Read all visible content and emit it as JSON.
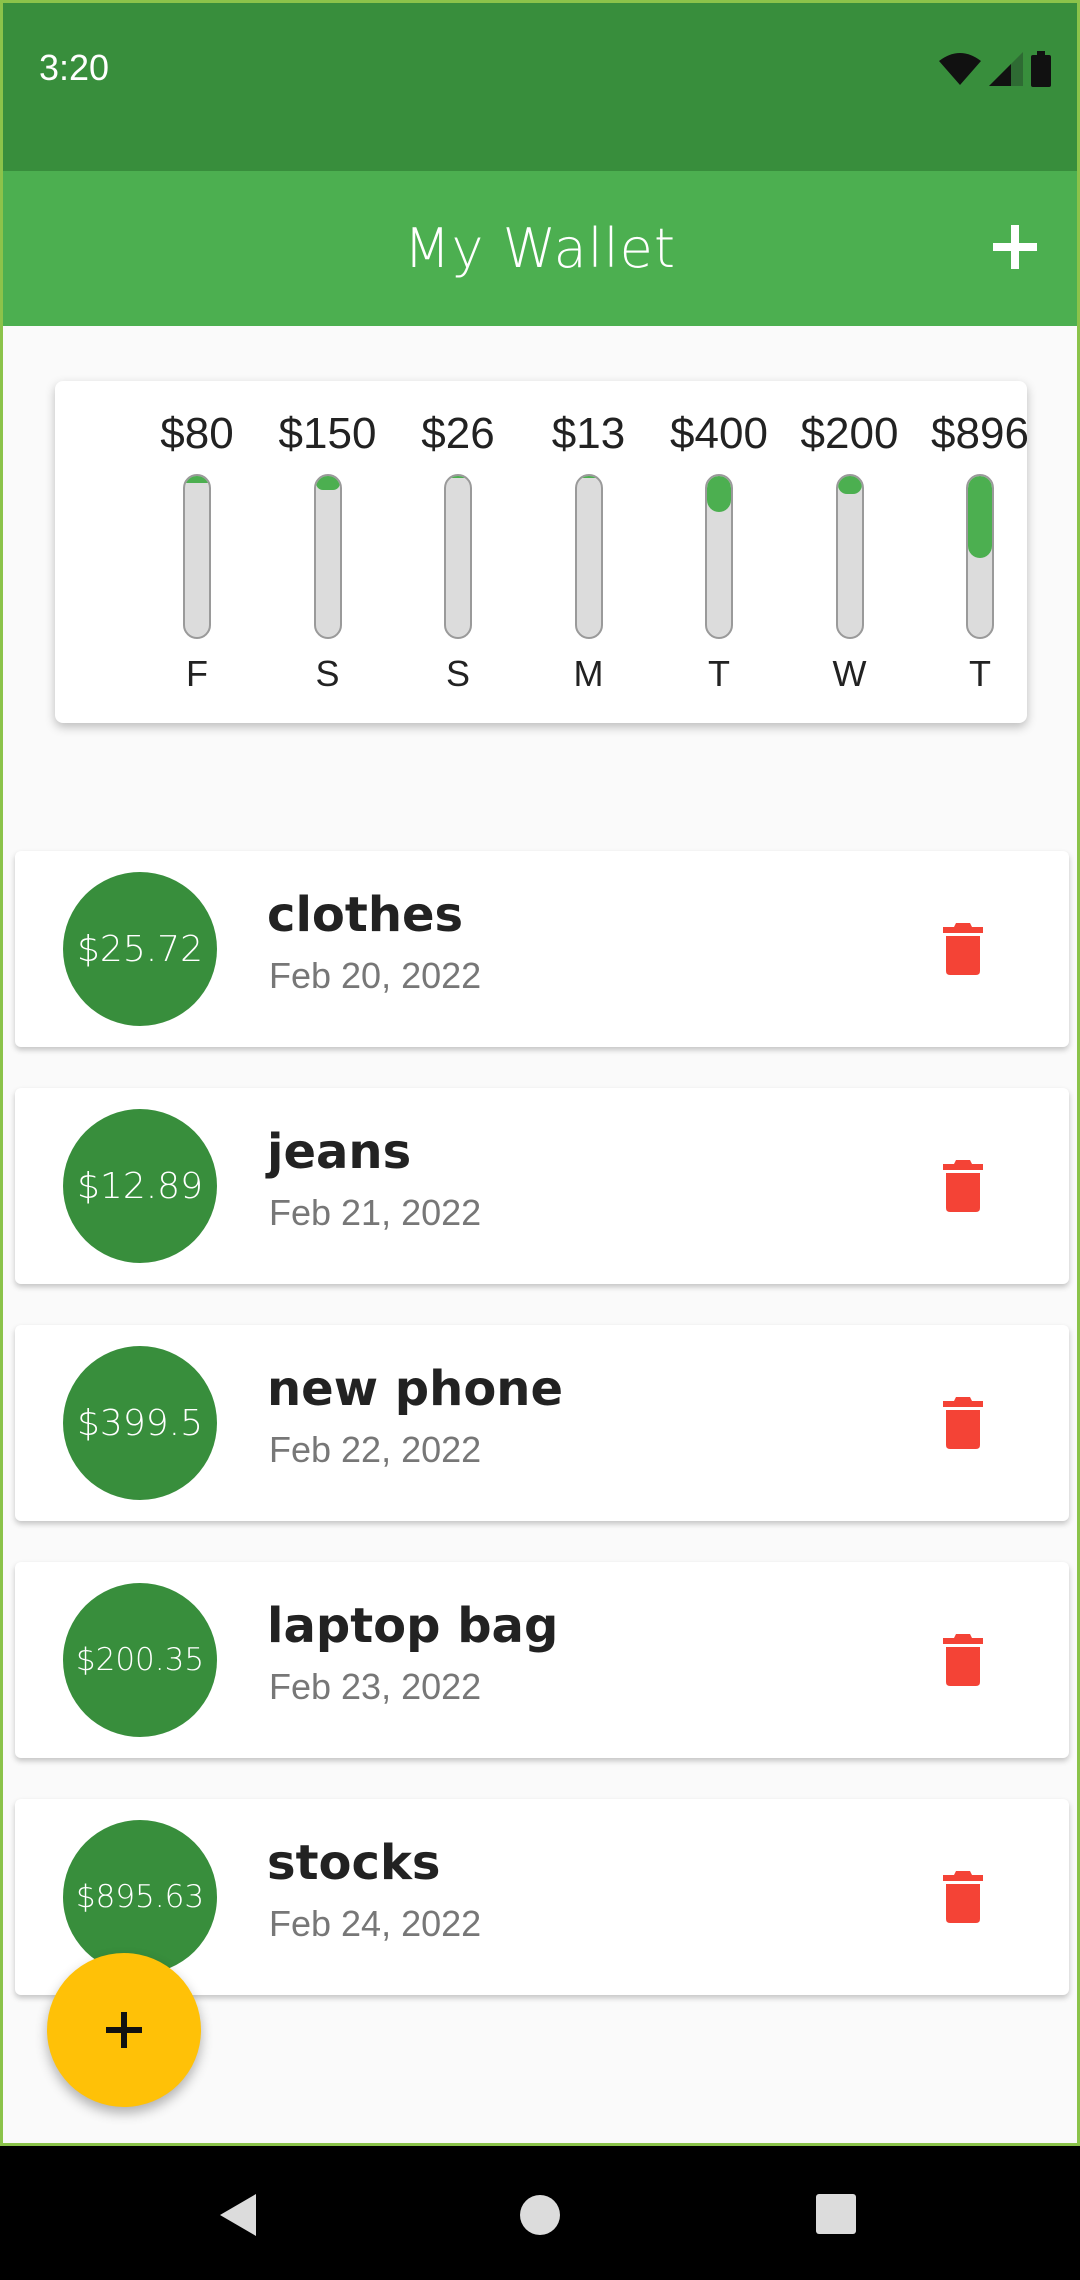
{
  "status_bar": {
    "time": "3:20"
  },
  "app_bar": {
    "title": "My Wallet"
  },
  "chart_data": {
    "type": "bar",
    "categories": [
      "F",
      "S",
      "S",
      "M",
      "T",
      "W",
      "T"
    ],
    "values": [
      80,
      150,
      26,
      13,
      400,
      200,
      896
    ],
    "labels": [
      "$80",
      "$150",
      "$26",
      "$13",
      "$400",
      "$200",
      "$896"
    ]
  },
  "transactions": [
    {
      "amount": "",
      "title": "",
      "date": ""
    },
    {
      "amount": "$25.72",
      "title": "clothes",
      "date": "Feb 20, 2022"
    },
    {
      "amount": "$12.89",
      "title": "jeans",
      "date": "Feb 21, 2022"
    },
    {
      "amount": "$399.5",
      "title": "new phone",
      "date": "Feb 22, 2022"
    },
    {
      "amount": "$200.35",
      "title": "laptop bag",
      "date": "Feb 23, 2022"
    },
    {
      "amount": "$895.63",
      "title": "stocks",
      "date": "Feb 24, 2022"
    }
  ],
  "colors": {
    "primary": "#4caf50",
    "primary_dark": "#388e3c",
    "accent": "#ffc107",
    "delete": "#f44336"
  },
  "icons": {
    "add": "plus-icon",
    "delete": "trash-icon",
    "fab": "plus-icon"
  }
}
